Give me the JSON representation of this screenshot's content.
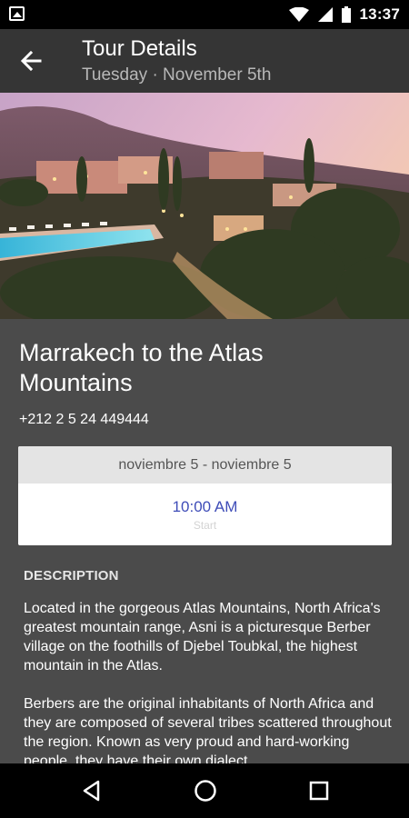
{
  "status_bar": {
    "time": "13:37",
    "icons": [
      "image-notification-icon",
      "wifi-icon",
      "cell-signal-icon",
      "battery-icon"
    ]
  },
  "app_bar": {
    "title": "Tour Details",
    "subtitle": "Tuesday · November 5th",
    "back_icon": "arrow-back-icon"
  },
  "hero": {
    "description_icon": "photo"
  },
  "tour": {
    "title": "Marrakech to the Atlas Mountains",
    "phone": "+212 2 5 24 449444"
  },
  "date_card": {
    "range": "noviembre 5 - noviembre 5",
    "start_time": "10:00 AM",
    "start_label": "Start"
  },
  "description": {
    "heading": "DESCRIPTION",
    "paragraph1": "Located in the gorgeous Atlas Mountains, North Africa's greatest mountain range, Asni is a picturesque Berber village on the foothills of Djebel Toubkal, the highest mountain in the Atlas.",
    "paragraph2": "Berbers are the original inhabitants of North Africa and they are composed of several tribes scattered throughout the region. Known as very proud and hard-working people, they have their own dialect,"
  },
  "nav_bar": {
    "icons": [
      "back-triangle-icon",
      "home-circle-icon",
      "recents-square-icon"
    ]
  },
  "colors": {
    "background": "#4b4b4b",
    "app_bar": "#353535",
    "accent_time": "#3f4db8"
  }
}
